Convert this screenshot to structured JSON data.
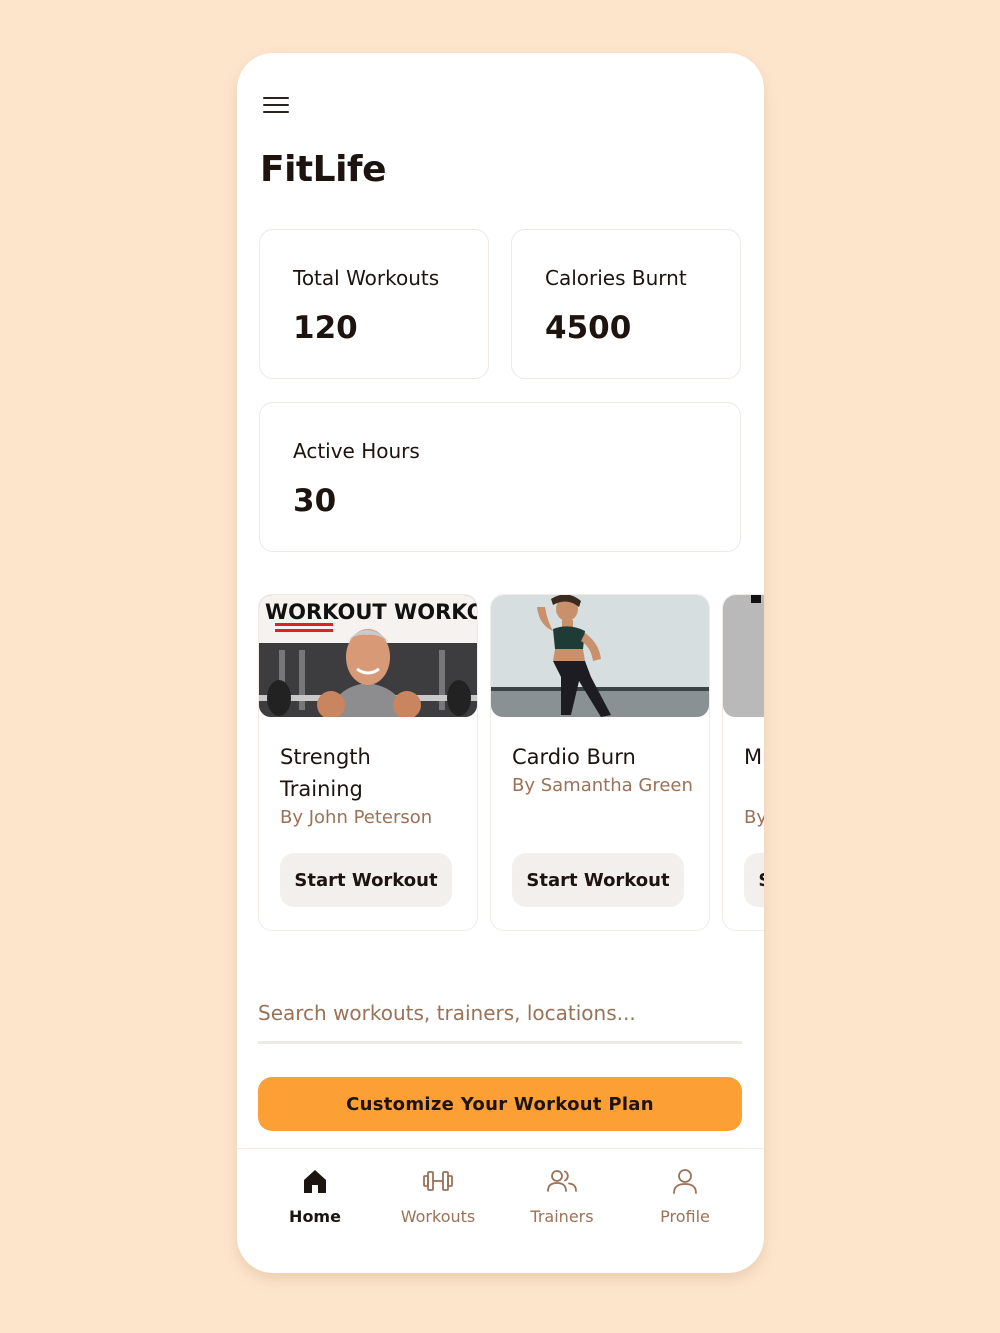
{
  "app": {
    "title": "FitLife"
  },
  "header": {
    "menu_icon": "hamburger-menu-icon"
  },
  "stats": [
    {
      "label": "Total Workouts",
      "value": "120"
    },
    {
      "label": "Calories Burnt",
      "value": "4500"
    },
    {
      "label": "Active Hours",
      "value": "30"
    }
  ],
  "workouts": [
    {
      "name": "Strength Training",
      "trainer": "By John Peterson",
      "button": "Start Workout",
      "image_banner": "WORKOUT WORKOUT"
    },
    {
      "name": "Cardio Burn",
      "trainer": "By Samantha Green",
      "button": "Start Workout"
    },
    {
      "name": "M... Is...",
      "trainer": "By...",
      "button": "Start Workout"
    }
  ],
  "search": {
    "placeholder": "Search workouts, trainers, locations..."
  },
  "cta": {
    "label": "Customize Your Workout Plan"
  },
  "nav": [
    {
      "label": "Home",
      "icon": "home-icon",
      "active": true
    },
    {
      "label": "Workouts",
      "icon": "dumbbell-icon",
      "active": false
    },
    {
      "label": "Trainers",
      "icon": "users-icon",
      "active": false
    },
    {
      "label": "Profile",
      "icon": "user-icon",
      "active": false
    }
  ],
  "colors": {
    "background": "#fde5cc",
    "accent": "#fc9f34",
    "muted_text": "#9a7257",
    "text": "#1d1410"
  }
}
